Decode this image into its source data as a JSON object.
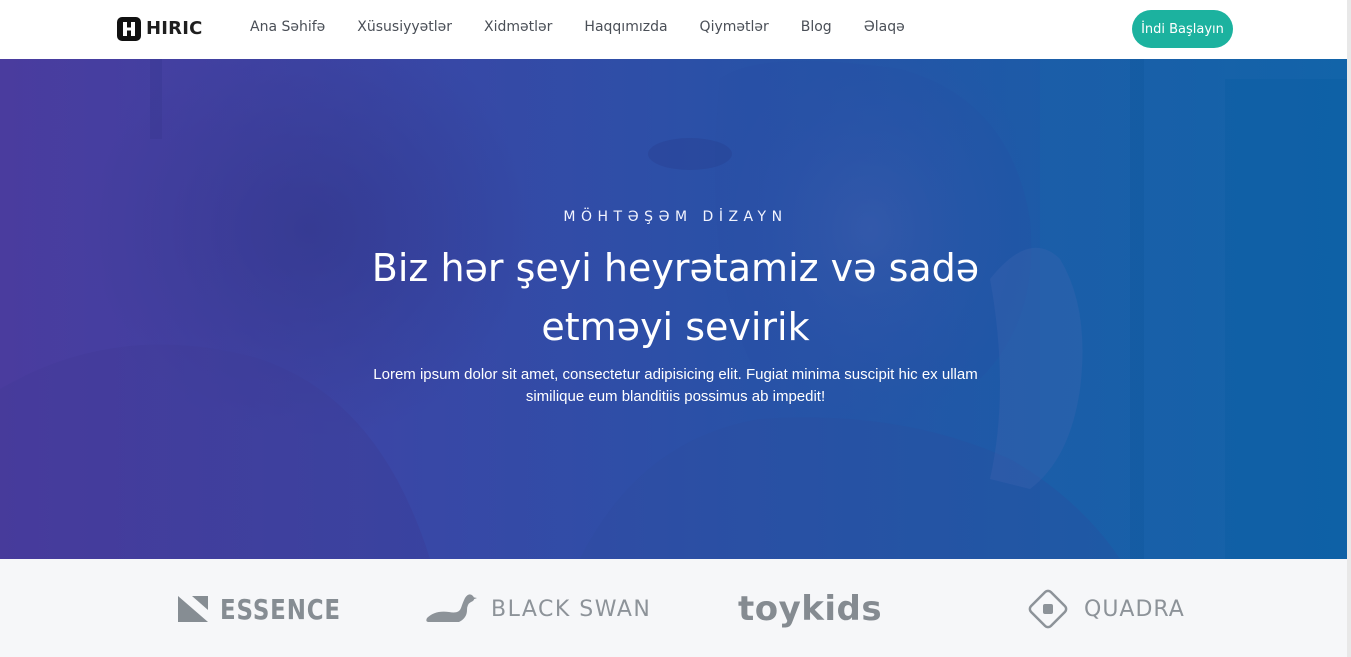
{
  "brand": {
    "name": "HIRIC",
    "logo_icon": "h-logo-icon"
  },
  "nav": {
    "items": [
      {
        "label": "Ana Səhifə"
      },
      {
        "label": "Xüsusiyyətlər"
      },
      {
        "label": "Xidmətlər"
      },
      {
        "label": "Haqqımızda"
      },
      {
        "label": "Qiymətlər"
      },
      {
        "label": "Blog"
      },
      {
        "label": "Əlaqə"
      }
    ],
    "cta_label": "İndi Başlayın"
  },
  "hero": {
    "eyebrow": "MÖHTƏŞƏM DİZAYN",
    "title": "Biz hər şeyi heyrətamiz və sadə etməyi sevirik",
    "subtitle": "Lorem ipsum dolor sit amet, consectetur adipisicing elit. Fugiat minima suscipit hic ex ullam similique eum blanditiis possimus ab impedit!"
  },
  "partners": [
    {
      "name": "ESSENCE",
      "icon": "essence-logo-icon"
    },
    {
      "name": "BLACK SWAN",
      "icon": "swan-logo-icon"
    },
    {
      "name": "toykids",
      "icon": ""
    },
    {
      "name": "QUADRA",
      "icon": "quadra-logo-icon"
    }
  ],
  "colors": {
    "accent": "#1cb29f",
    "hero_gradient_start": "#4a3e9c",
    "hero_gradient_end": "#1a64a8",
    "partner_gray": "#8d9399"
  }
}
